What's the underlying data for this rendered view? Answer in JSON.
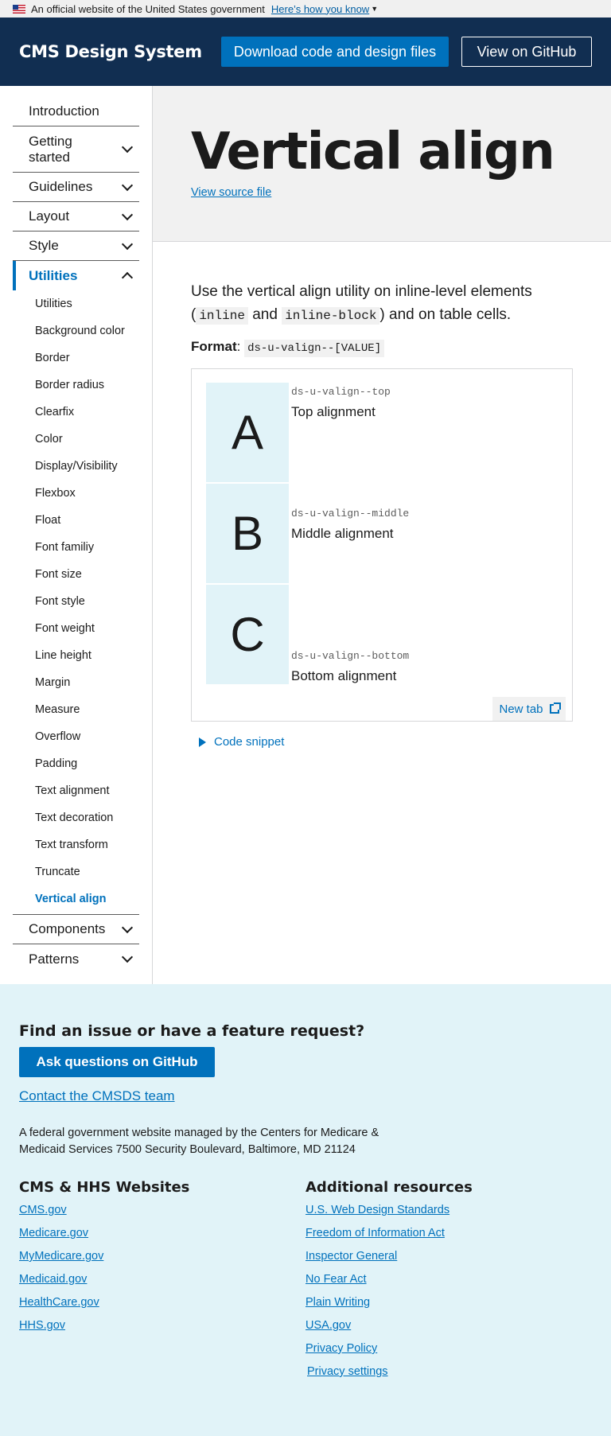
{
  "gov_banner": {
    "text": "An official website of the United States government",
    "link": "Here’s how you know"
  },
  "header": {
    "site_title": "CMS Design System",
    "download_button": "Download code and design files",
    "github_button": "View on GitHub"
  },
  "sidebar": {
    "top_items": {
      "introduction": "Introduction",
      "getting_started": "Getting started",
      "guidelines": "Guidelines",
      "layout": "Layout",
      "style": "Style",
      "utilities": "Utilities",
      "components": "Components",
      "patterns": "Patterns"
    },
    "utilities_items": [
      "Utilities",
      "Background color",
      "Border",
      "Border radius",
      "Clearfix",
      "Color",
      "Display/Visibility",
      "Flexbox",
      "Float",
      "Font familiy",
      "Font size",
      "Font style",
      "Font weight",
      "Line height",
      "Margin",
      "Measure",
      "Overflow",
      "Padding",
      "Text alignment",
      "Text decoration",
      "Text transform",
      "Truncate",
      "Vertical align"
    ]
  },
  "hero": {
    "title": "Vertical align",
    "source_link": "View source file"
  },
  "content": {
    "lead_part1": "Use the vertical align utility on inline-level elements (",
    "code_inline": "inline",
    "lead_and": " and ",
    "code_inline_block": "inline-block",
    "lead_part2": ") and on table cells.",
    "format_label": "Format",
    "format_colon": ": ",
    "format_code": "ds-u-valign--[VALUE]"
  },
  "example": {
    "rows": [
      {
        "letter": "A",
        "code": "ds-u-valign--top",
        "label": "Top alignment"
      },
      {
        "letter": "B",
        "code": "ds-u-valign--middle",
        "label": "Middle alignment"
      },
      {
        "letter": "C",
        "code": "ds-u-valign--bottom",
        "label": "Bottom alignment"
      }
    ],
    "new_tab": "New tab",
    "code_snippet": "Code snippet"
  },
  "footer": {
    "feedback_heading": "Find an issue or have a feature request?",
    "github_button": "Ask questions on GitHub",
    "contact_link": "Contact the CMSDS team",
    "federal_text": "A federal government website managed by the Centers for Medicare & Medicaid Services 7500 Security Boulevard, Baltimore, MD 21124",
    "cms_heading": "CMS & HHS Websites",
    "cms_links": [
      "CMS.gov",
      "Medicare.gov",
      "MyMedicare.gov",
      "Medicaid.gov",
      "HealthCare.gov",
      "HHS.gov"
    ],
    "resources_heading": "Additional resources",
    "resources_links": [
      "U.S. Web Design Standards",
      "Freedom of Information Act",
      "Inspector General",
      "No Fear Act",
      "Plain Writing",
      "USA.gov",
      "Privacy Policy",
      "Privacy settings"
    ]
  }
}
